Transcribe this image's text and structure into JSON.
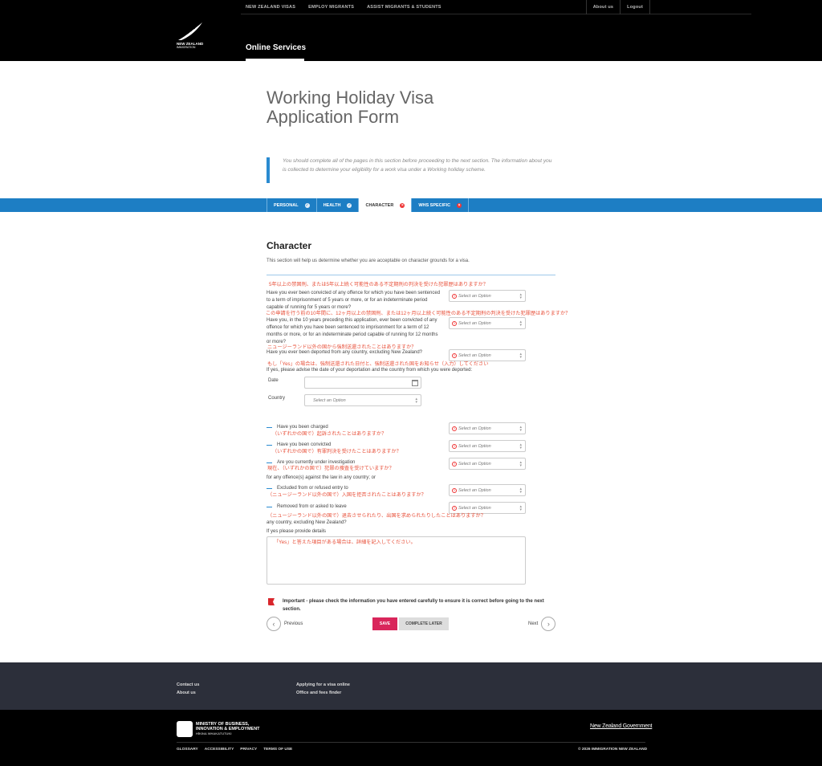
{
  "header": {
    "nav_left": [
      "NEW ZEALAND VISAS",
      "EMPLOY MIGRANTS",
      "ASSIST MIGRANTS & STUDENTS"
    ],
    "nav_right": [
      "About us",
      "Logout"
    ],
    "logo_line1": "NEW ZEALAND",
    "logo_line2": "IMMIGRATION",
    "online_services": "Online Services"
  },
  "page": {
    "title": "Working Holiday Visa Application Form",
    "intro": "You should complete all of the pages in this section before proceeding to the next section. The information about you is collected to determine your eligibility for a work visa under a Working holiday scheme."
  },
  "tabs": [
    {
      "label": "PERSONAL",
      "status": "done"
    },
    {
      "label": "HEALTH",
      "status": "done"
    },
    {
      "label": "CHARACTER",
      "status": "error"
    },
    {
      "label": "WHS SPECIFIC",
      "status": "error"
    }
  ],
  "section": {
    "title": "Character",
    "description": "This section will help us determine whether you are acceptable on character grounds for a visa."
  },
  "questions": {
    "q1_jp": "5年以上の禁固刑、または5年以上続く可能性のある不定期刑の判決を受けた犯罪歴はありますか？",
    "q1": "Have you ever been convicted of any offence for which you have been sentenced to a term of imprisonment of 5 years or more, or for an indeterminate period capable of running for 5 years or more?",
    "q2_jp": "この申請を行う前の10年間に、12ヶ月以上の禁固刑、または12ヶ月以上続く可能性のある不定期刑の判決を受けた犯罪歴はありますか？",
    "q2": "Have you, in the 10 years preceding this application, ever been convicted of any offence for which you have been sentenced to imprisonment for a term of 12 months or more, or for an indeterminate period capable of running for 12 months or more?",
    "q3_jp": "ニュージーランド以外の国から強制送還されたことはありますか？",
    "q3": "Have you ever been deported from any country, excluding New Zealand?",
    "q3_follow_jp": "もし「Yes」の場合は、強制送還された日付と、強制送還された国をお知らせ（入力）してください",
    "q3_follow": "If yes, please advise the date of your deportation and the country from which you were deported:",
    "date_label": "Date",
    "country_label": "Country",
    "country_placeholder": "Select an Option",
    "select_placeholder": "Select an Option",
    "charged": "Have you been charged",
    "charged_jp": "（いずれかの国で）起訴されたことはありますか？",
    "convicted": "Have you been convicted",
    "convicted_jp": "（いずれかの国で）有罪判決を受けたことはありますか？",
    "investigation": "Are you currently under investigation",
    "investigation_jp": "現在、（いずれかの国で）犯罪の捜査を受けていますか？",
    "for_any_offence": "for any offence(s) against the law in any country; or",
    "excluded": "Excluded from or refused entry to",
    "excluded_jp": "（ニュージーランド以外の国で）入国を拒否されたことはありますか？",
    "removed": "Removed from or asked to leave",
    "removed_jp": "（ニュージーランド以外の国で）退去させられたり、出国を求められたりしたことはありますか？",
    "any_country": "any country, excluding New Zealand?",
    "details_label": "If yes please provide details",
    "details_jp": "「Yes」と答えた項目がある場合は、詳細を記入してください。"
  },
  "important": "Important - please check the information you have entered carefully to ensure it is correct before going to the next section.",
  "buttons": {
    "previous": "Previous",
    "save": "SAVE",
    "complete_later": "COMPLETE LATER",
    "next": "Next"
  },
  "footer": {
    "links_col1": [
      "Contact us",
      "About us"
    ],
    "links_col2": [
      "Applying for a visa online",
      "Office and fees finder"
    ],
    "mbie_line1": "MINISTRY OF BUSINESS,",
    "mbie_line2": "INNOVATION & EMPLOYMENT",
    "mbie_sub": "HĪKINA WHAKATUTUKI",
    "nzgov": "New Zealand Government",
    "bottom_links": [
      "GLOSSARY",
      "ACCESSIBILITY",
      "PRIVACY",
      "TERMS OF USE"
    ],
    "copyright": "© 2026 IMMIGRATION NEW ZEALAND"
  },
  "colors": {
    "accent_blue": "#1d7ec4",
    "annotation_red": "#e8503a",
    "save_pink": "#d9265b"
  }
}
